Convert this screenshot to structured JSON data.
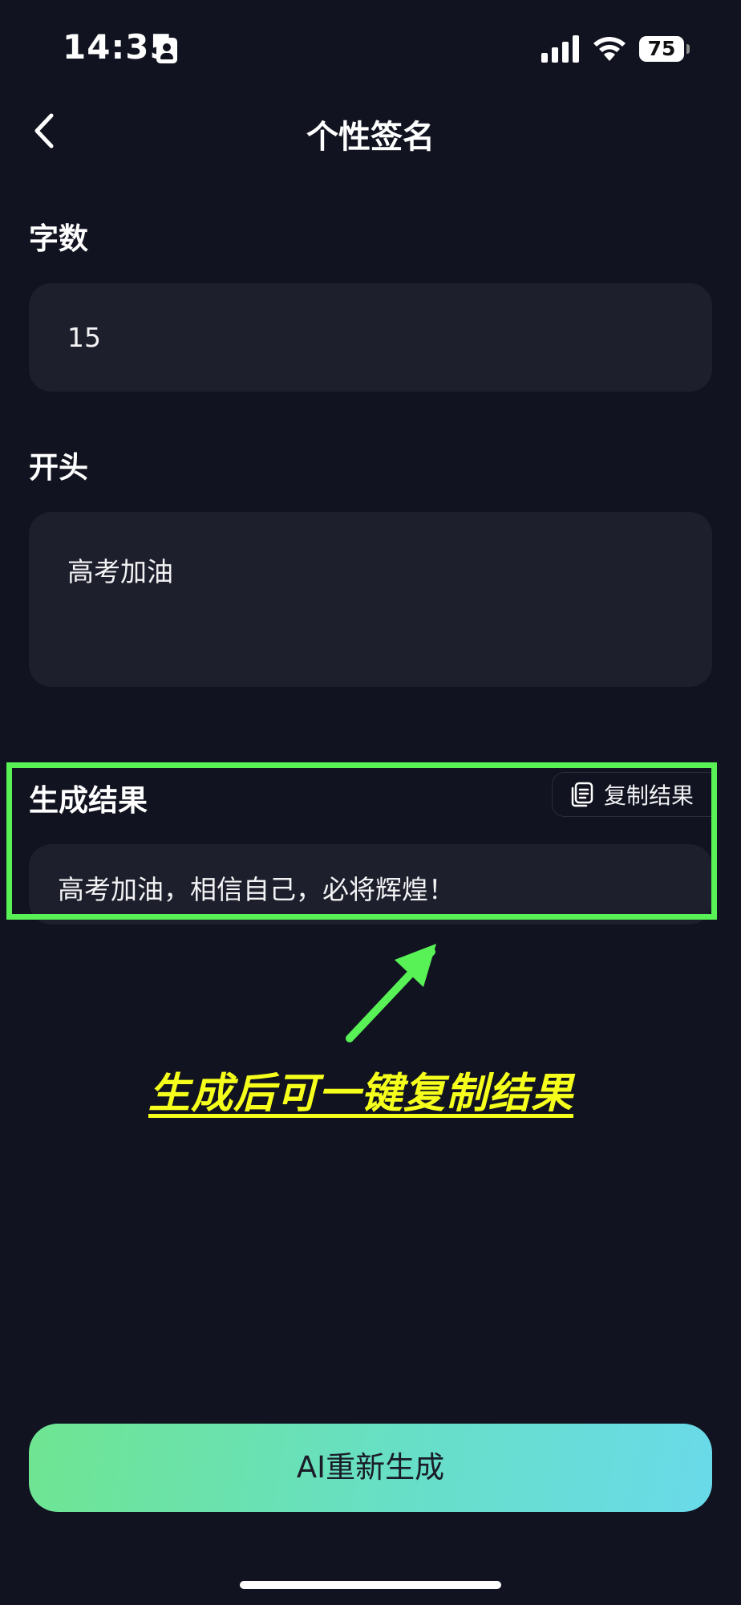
{
  "status_bar": {
    "time": "14:35",
    "battery": "75"
  },
  "nav": {
    "title": "个性签名"
  },
  "form": {
    "word_count_label": "字数",
    "word_count_value": "15",
    "opening_label": "开头",
    "opening_value": "高考加油"
  },
  "result": {
    "label": "生成结果",
    "copy_button": "复制结果",
    "text": "高考加油，相信自己，必将辉煌！"
  },
  "annotation": {
    "callout": "生成后可一键复制结果",
    "highlight_color": "#58f256",
    "callout_color": "#f6ff1b"
  },
  "actions": {
    "regenerate": "AI重新生成"
  },
  "colors": {
    "background": "#111320",
    "panel": "#1d1f2c",
    "button_gradient_start": "#6fe591",
    "button_gradient_end": "#69dae9"
  }
}
